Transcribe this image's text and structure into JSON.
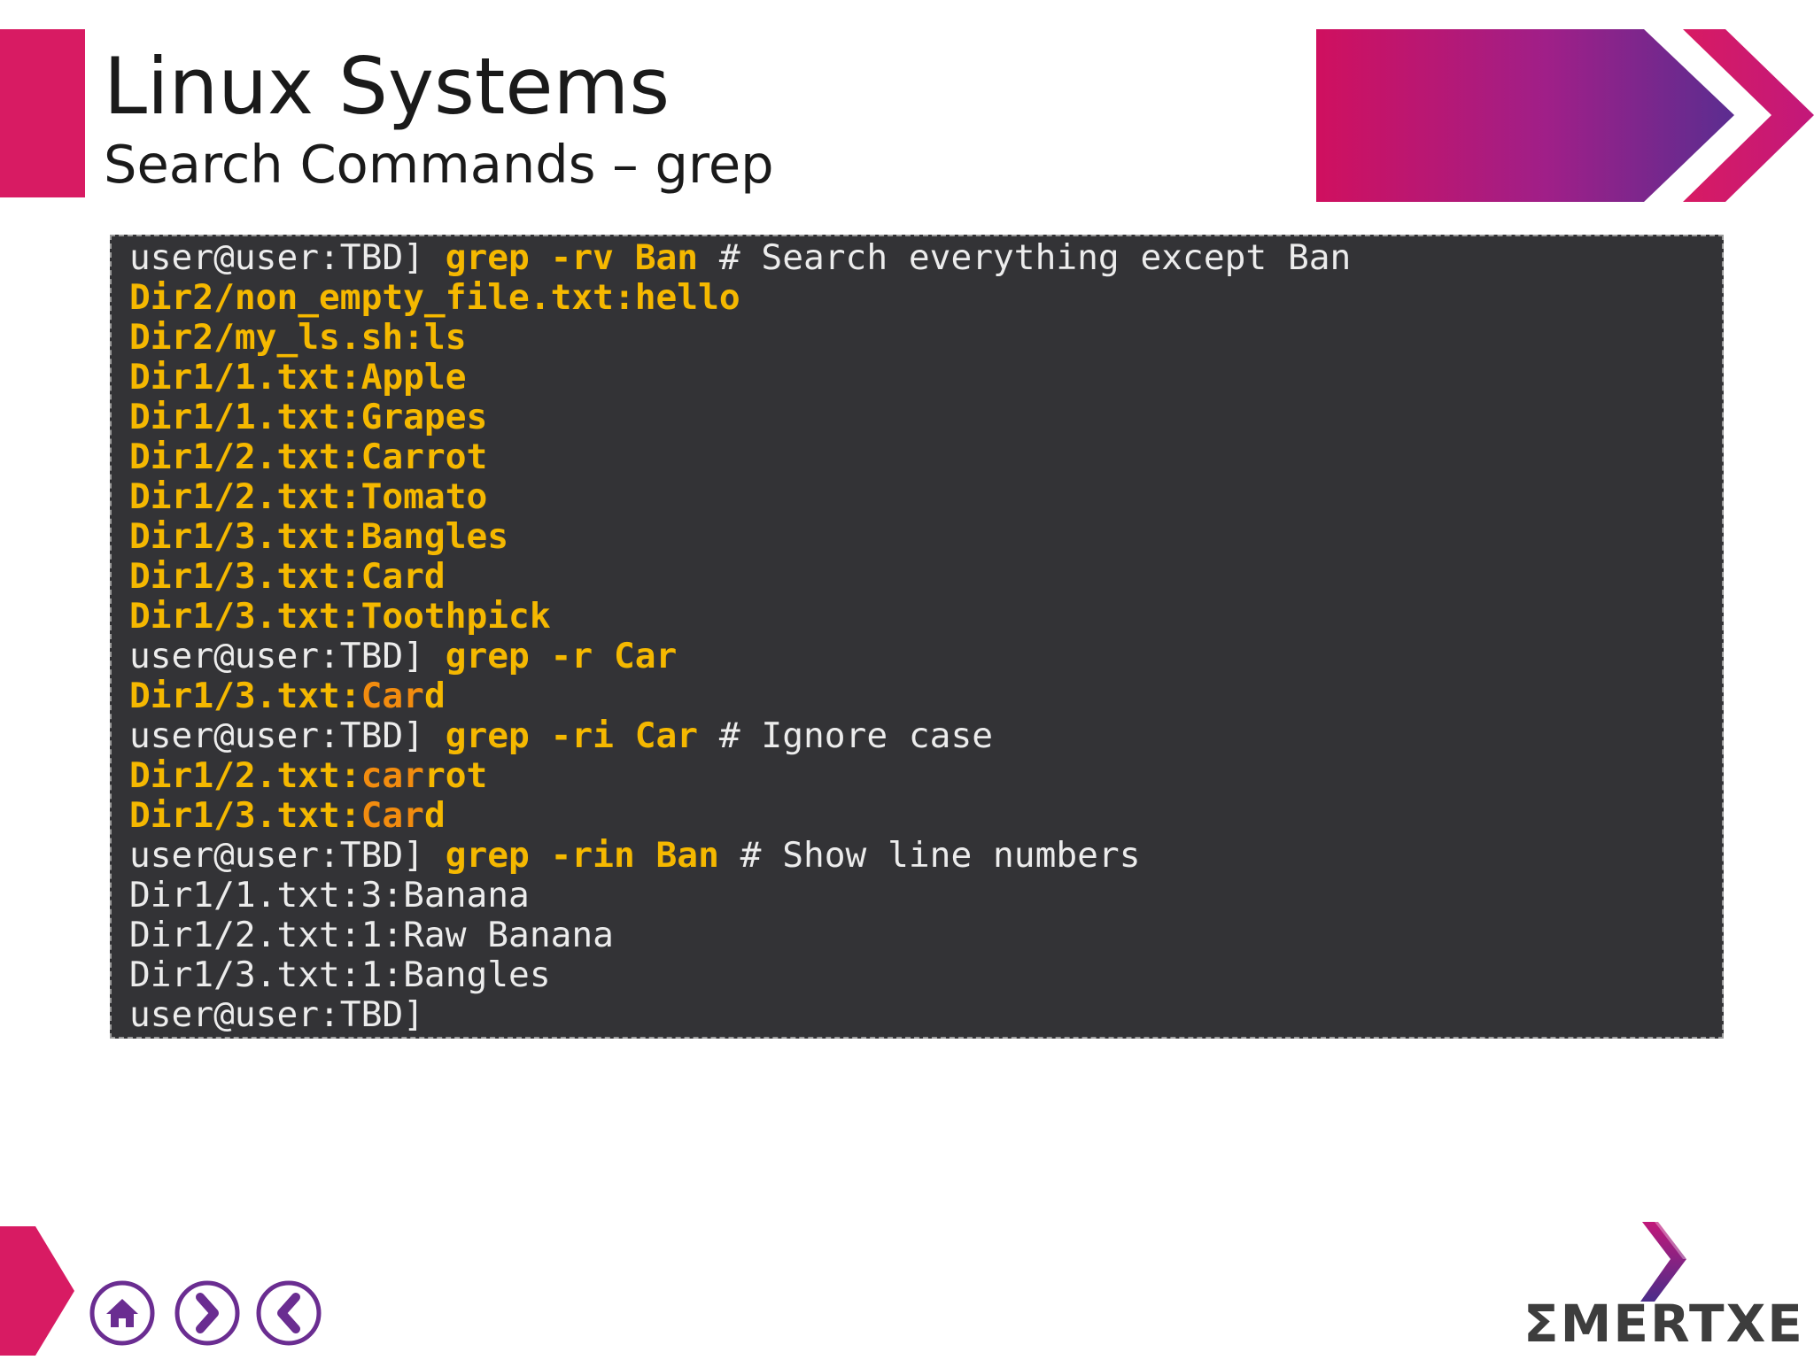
{
  "slide": {
    "title": "Linux Systems",
    "subtitle": "Search Commands – grep"
  },
  "terminal": {
    "lines": [
      [
        {
          "t": "user@user:TBD] ",
          "c": "w"
        },
        {
          "t": "grep -rv Ban",
          "c": "y"
        },
        {
          "t": " # Search everything except Ban",
          "c": "w"
        }
      ],
      [
        {
          "t": "Dir2/non_empty_file.txt:hello",
          "c": "y"
        }
      ],
      [
        {
          "t": "Dir2/my_ls.sh:ls",
          "c": "y"
        }
      ],
      [
        {
          "t": "Dir1/1.txt:Apple",
          "c": "y"
        }
      ],
      [
        {
          "t": "Dir1/1.txt:Grapes",
          "c": "y"
        }
      ],
      [
        {
          "t": "Dir1/2.txt:Carrot",
          "c": "y"
        }
      ],
      [
        {
          "t": "Dir1/2.txt:Tomato",
          "c": "y"
        }
      ],
      [
        {
          "t": "Dir1/3.txt:Bangles",
          "c": "y"
        }
      ],
      [
        {
          "t": "Dir1/3.txt:Card",
          "c": "y"
        }
      ],
      [
        {
          "t": "Dir1/3.txt:Toothpick",
          "c": "y"
        }
      ],
      [
        {
          "t": "user@user:TBD] ",
          "c": "w"
        },
        {
          "t": "grep -r Car",
          "c": "y"
        }
      ],
      [
        {
          "t": "Dir1/3.txt:",
          "c": "y"
        },
        {
          "t": "Car",
          "c": "o"
        },
        {
          "t": "d",
          "c": "y"
        }
      ],
      [
        {
          "t": "user@user:TBD] ",
          "c": "w"
        },
        {
          "t": "grep -ri Car",
          "c": "y"
        },
        {
          "t": " # Ignore case",
          "c": "w"
        }
      ],
      [
        {
          "t": "Dir1/2.txt:",
          "c": "y"
        },
        {
          "t": "car",
          "c": "o"
        },
        {
          "t": "rot",
          "c": "y"
        }
      ],
      [
        {
          "t": "Dir1/3.txt:",
          "c": "y"
        },
        {
          "t": "Car",
          "c": "o"
        },
        {
          "t": "d",
          "c": "y"
        }
      ],
      [
        {
          "t": "user@user:TBD] ",
          "c": "w"
        },
        {
          "t": "grep -rin Ban",
          "c": "y"
        },
        {
          "t": " # Show line numbers",
          "c": "w"
        }
      ],
      [
        {
          "t": "Dir1/1.txt:3:Banana",
          "c": "w"
        }
      ],
      [
        {
          "t": "Dir1/2.txt:1:Raw Banana",
          "c": "w"
        }
      ],
      [
        {
          "t": "Dir1/3.txt:1:Bangles",
          "c": "w"
        }
      ],
      [
        {
          "t": "user@user:TBD]",
          "c": "w"
        }
      ]
    ]
  },
  "nav": {
    "home_icon": "home-icon",
    "next_icon": "chevron-right-icon",
    "prev_icon": "chevron-left-icon"
  },
  "logo": {
    "text": "ΣMERTXE"
  },
  "colors": {
    "accent_pink": "#d81b63",
    "accent_purple": "#5b2d90",
    "terminal_bg": "#333336",
    "highlight_yellow": "#f5b800",
    "match_orange": "#f28c0f"
  }
}
